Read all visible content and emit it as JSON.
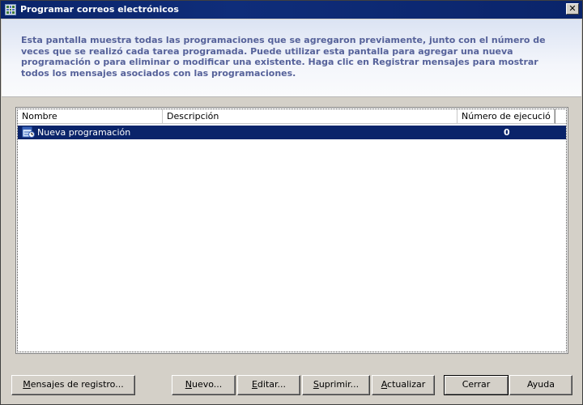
{
  "window": {
    "title": "Programar correos electrónicos",
    "close_glyph": "✕"
  },
  "header": {
    "description": "Esta pantalla muestra todas las programaciones que se agregaron previamente, junto con el número de veces que se realizó cada tarea programada. Puede utilizar esta pantalla para agregar una nueva programación o para eliminar o modificar una existente. Haga clic en Registrar mensajes para mostrar todos los mensajes asociados con las programaciones."
  },
  "list": {
    "columns": [
      "Nombre",
      "Descripción",
      "Número de ejecució"
    ],
    "rows": [
      {
        "name": "Nueva programación",
        "description": "",
        "count": "0",
        "selected": true
      }
    ]
  },
  "buttons": {
    "log": {
      "pre": "",
      "key": "M",
      "post": "ensajes de registro..."
    },
    "new": {
      "pre": "",
      "key": "N",
      "post": "uevo..."
    },
    "edit": {
      "pre": "",
      "key": "E",
      "post": "ditar..."
    },
    "delete": {
      "pre": "",
      "key": "S",
      "post": "uprimir..."
    },
    "refresh": {
      "pre": "",
      "key": "A",
      "post": "ctualizar"
    },
    "close": {
      "pre": "",
      "key": "",
      "post": "Cerrar"
    },
    "help": {
      "pre": "",
      "key": "",
      "post": "Ayuda"
    }
  },
  "colors": {
    "selection": "#0a246a",
    "header_text": "#56629a",
    "title_bar": "#0a246a"
  }
}
